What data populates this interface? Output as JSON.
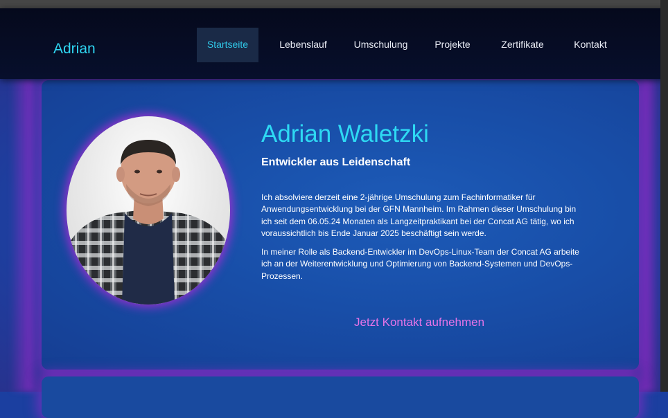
{
  "navbar": {
    "brand": "Adrian",
    "items": [
      {
        "label": "Startseite",
        "active": true
      },
      {
        "label": "Lebenslauf",
        "active": false
      },
      {
        "label": "Umschulung",
        "active": false
      },
      {
        "label": "Projekte",
        "active": false
      },
      {
        "label": "Zertifikate",
        "active": false
      },
      {
        "label": "Kontakt",
        "active": false
      }
    ]
  },
  "hero": {
    "name": "Adrian Waletzki",
    "tagline": "Entwickler aus Leidenschaft",
    "paragraphs": [
      "Ich absolviere derzeit eine 2-jährige Umschulung zum Fachinformatiker für Anwendungsentwicklung bei der GFN Mannheim. Im Rahmen dieser Umschulung bin ich seit dem 06.05.24 Monaten als Langzeitpraktikant bei der Concat AG tätig, wo ich voraussichtlich bis Ende Januar 2025 beschäftigt sein werde.",
      "In meiner Rolle als Backend-Entwickler im DevOps-Linux-Team der Concat AG arbeite ich an der Weiterentwicklung und Optimierung von Backend-Systemen und DevOps-Prozessen."
    ],
    "cta": "Jetzt Kontakt aufnehmen"
  },
  "colors": {
    "accent_cyan": "#2ed9f3",
    "accent_pink": "#e774e8",
    "glow_purple": "#a528d2",
    "navbar_bg": "#05091c",
    "card_bg": "#184ea8"
  }
}
